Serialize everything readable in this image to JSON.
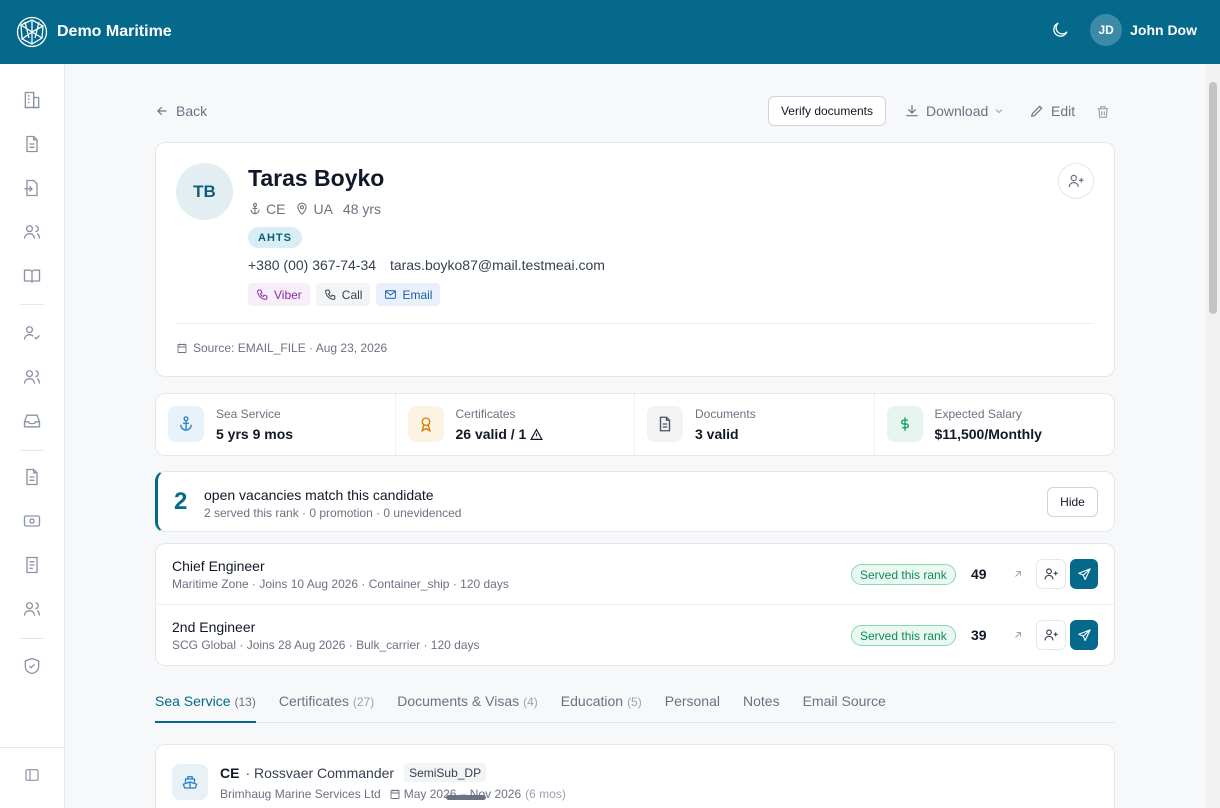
{
  "app": {
    "brand": "Demo Maritime"
  },
  "user": {
    "initials": "JD",
    "name": "John Dow"
  },
  "toolbar": {
    "back": "Back",
    "verify": "Verify documents",
    "download": "Download",
    "edit": "Edit"
  },
  "candidate": {
    "initials": "TB",
    "name": "Taras Boyko",
    "rank": "CE",
    "country": "UA",
    "age": "48 yrs",
    "vessel_tag": "AHTS",
    "phone": "+380 (00) 367-74-34",
    "email": "taras.boyko87@mail.testmeai.com",
    "chips": {
      "viber": "Viber",
      "call": "Call",
      "email": "Email"
    },
    "source": "Source: EMAIL_FILE · Aug 23, 2026"
  },
  "stats": [
    {
      "label": "Sea Service",
      "value": "5 yrs 9 mos",
      "icon": "anchor-icon",
      "color": "#2b7fbf"
    },
    {
      "label": "Certificates",
      "value": "26 valid / 1",
      "icon": "award-icon",
      "color": "#d97a06"
    },
    {
      "label": "Documents",
      "value": "3 valid",
      "icon": "document-icon",
      "color": "#4b5563"
    },
    {
      "label": "Expected Salary",
      "value": "$11,500/Monthly",
      "icon": "dollar-icon",
      "color": "#16a065"
    }
  ],
  "match": {
    "count": "2",
    "title": "open vacancies match this candidate",
    "subtitle": "2 served this rank · 0 promotion · 0 unevidenced",
    "hide": "Hide"
  },
  "vacancies": [
    {
      "title": "Chief Engineer",
      "meta": "Maritime Zone · Joins 10 Aug 2026 · Container_ship · 120 days",
      "badge": "Served this rank",
      "score": "49"
    },
    {
      "title": "2nd Engineer",
      "meta": "SCG Global · Joins 28 Aug 2026 · Bulk_carrier · 120 days",
      "badge": "Served this rank",
      "score": "39"
    }
  ],
  "tabs": [
    {
      "label": "Sea Service",
      "count": "(13)"
    },
    {
      "label": "Certificates",
      "count": "(27)"
    },
    {
      "label": "Documents & Visas",
      "count": "(4)"
    },
    {
      "label": "Education",
      "count": "(5)"
    },
    {
      "label": "Personal",
      "count": ""
    },
    {
      "label": "Notes",
      "count": ""
    },
    {
      "label": "Email Source",
      "count": ""
    }
  ],
  "service_record": {
    "rank": "CE",
    "vessel": "· Rossvaer Commander",
    "vessel_type": "SemiSub_DP",
    "company": "Brimhaug Marine Services Ltd",
    "period": "May 2026 – Nov 2026",
    "duration": "(6 mos)"
  },
  "colors": {
    "brand": "#05698c",
    "success": "#128a5a"
  }
}
